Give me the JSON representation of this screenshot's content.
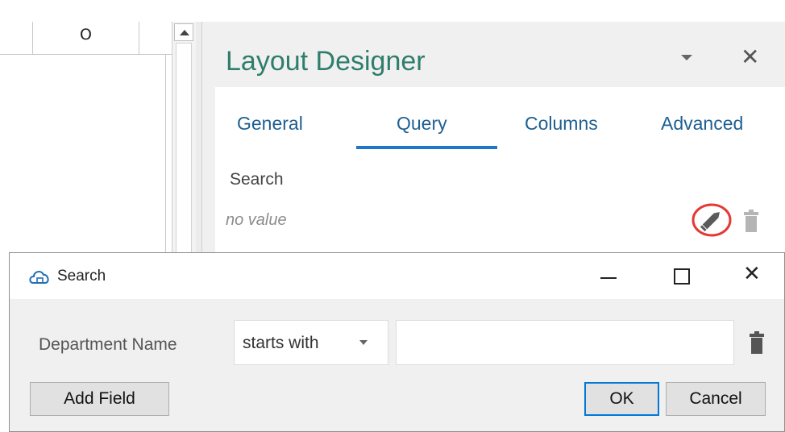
{
  "sheet": {
    "column_label": "O"
  },
  "designer": {
    "title": "Layout Designer",
    "tabs": [
      {
        "label": "General"
      },
      {
        "label": "Query"
      },
      {
        "label": "Columns"
      },
      {
        "label": "Advanced"
      }
    ],
    "active_tab": "Query",
    "search_label": "Search",
    "search_value": "no value",
    "edit_highlight_color": "#e53935"
  },
  "dialog": {
    "title": "Search",
    "field_label": "Department Name",
    "operator": "starts with",
    "value": "",
    "buttons": {
      "add_field": "Add Field",
      "ok": "OK",
      "cancel": "Cancel"
    }
  },
  "colors": {
    "accent": "#1e77c8",
    "title_green": "#2f7d6b",
    "tab_blue": "#1f5f91"
  }
}
